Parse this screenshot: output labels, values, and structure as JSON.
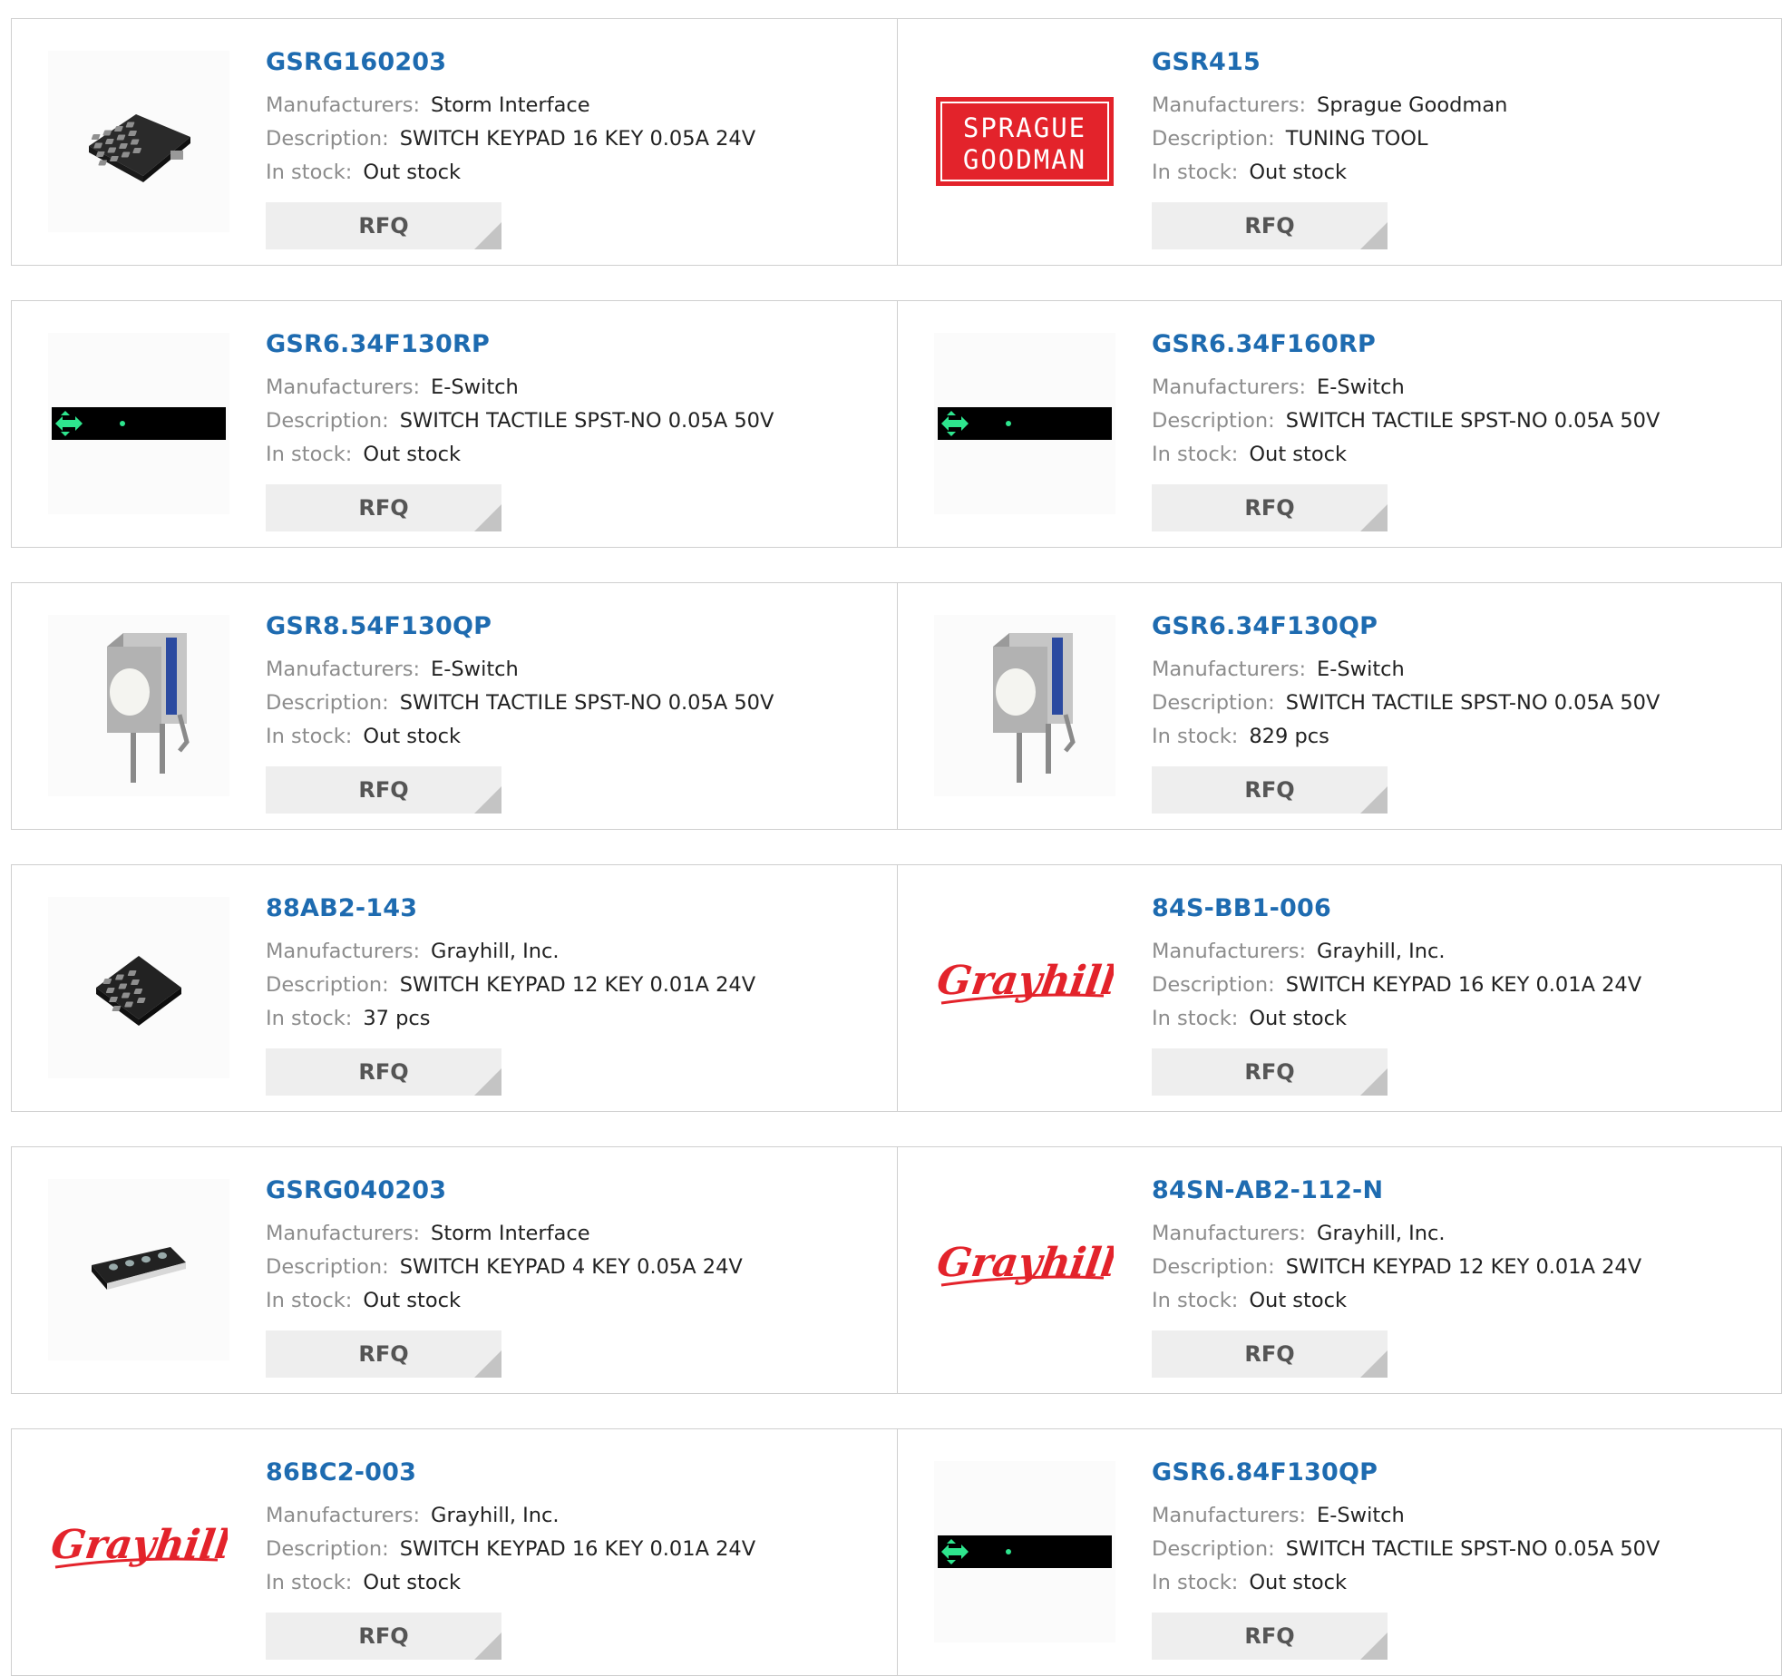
{
  "labels": {
    "manufacturers": "Manufacturers:",
    "description": "Description:",
    "in_stock": "In stock:",
    "rfq": "RFQ"
  },
  "products": [
    {
      "part": "GSRG160203",
      "manufacturer": "Storm Interface",
      "description": "SWITCH KEYPAD 16 KEY 0.05A 24V",
      "stock": "Out stock",
      "image": "keypad-16-icon"
    },
    {
      "part": "GSR415",
      "manufacturer": "Sprague Goodman",
      "description": "TUNING TOOL",
      "stock": "Out stock",
      "image": "sprague-goodman-logo",
      "logo_text": [
        "SPRAGUE",
        "GOODMAN"
      ]
    },
    {
      "part": "GSR6.34F130RP",
      "manufacturer": "E-Switch",
      "description": "SWITCH TACTILE SPST-NO 0.05A 50V",
      "stock": "Out stock",
      "image": "led-strip-icon"
    },
    {
      "part": "GSR6.34F160RP",
      "manufacturer": "E-Switch",
      "description": "SWITCH TACTILE SPST-NO 0.05A 50V",
      "stock": "Out stock",
      "image": "led-strip-icon"
    },
    {
      "part": "GSR8.54F130QP",
      "manufacturer": "E-Switch",
      "description": "SWITCH TACTILE SPST-NO 0.05A 50V",
      "stock": "Out stock",
      "image": "tactile-switch-icon"
    },
    {
      "part": "GSR6.34F130QP",
      "manufacturer": "E-Switch",
      "description": "SWITCH TACTILE SPST-NO 0.05A 50V",
      "stock": "829 pcs",
      "image": "tactile-switch-icon"
    },
    {
      "part": "88AB2-143",
      "manufacturer": "Grayhill, Inc.",
      "description": "SWITCH KEYPAD 12 KEY 0.01A 24V",
      "stock": "37 pcs",
      "image": "keypad-12-icon"
    },
    {
      "part": "84S-BB1-006",
      "manufacturer": "Grayhill, Inc.",
      "description": "SWITCH KEYPAD 16 KEY 0.01A 24V",
      "stock": "Out stock",
      "image": "grayhill-logo",
      "logo_text": [
        "Grayhill"
      ]
    },
    {
      "part": "GSRG040203",
      "manufacturer": "Storm Interface",
      "description": "SWITCH KEYPAD 4 KEY 0.05A 24V",
      "stock": "Out stock",
      "image": "keypad-4-icon"
    },
    {
      "part": "84SN-AB2-112-N",
      "manufacturer": "Grayhill, Inc.",
      "description": "SWITCH KEYPAD 12 KEY 0.01A 24V",
      "stock": "Out stock",
      "image": "grayhill-logo",
      "logo_text": [
        "Grayhill"
      ]
    },
    {
      "part": "86BC2-003",
      "manufacturer": "Grayhill, Inc.",
      "description": "SWITCH KEYPAD 16 KEY 0.01A 24V",
      "stock": "Out stock",
      "image": "grayhill-logo",
      "logo_text": [
        "Grayhill"
      ]
    },
    {
      "part": "GSR6.84F130QP",
      "manufacturer": "E-Switch",
      "description": "SWITCH TACTILE SPST-NO 0.05A 50V",
      "stock": "Out stock",
      "image": "led-strip-icon"
    }
  ],
  "colors": {
    "link": "#1e6bb0",
    "label": "#8c8c8c",
    "button_bg": "#eeeeee",
    "border": "#cfcfcf",
    "logo_red": "#e3232b"
  }
}
